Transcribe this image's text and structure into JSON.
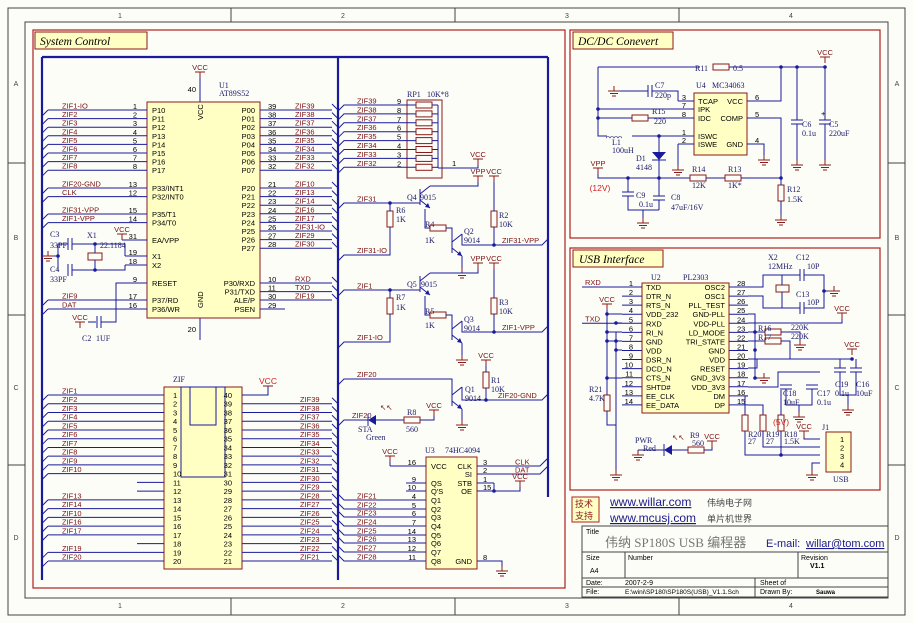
{
  "frame": {
    "columns": [
      "1",
      "2",
      "3",
      "4"
    ],
    "rows": [
      "A",
      "B",
      "C",
      "D"
    ]
  },
  "sections": {
    "system": "System Control",
    "dcdc": "DC/DC Conevert",
    "usb": "USB Interface"
  },
  "power": {
    "vcc": "VCC",
    "vpp": "VPP",
    "v12": "(12V)",
    "v5": "(5V)"
  },
  "u1": {
    "ref": "U1",
    "part": "AT89S52",
    "vcc_pin": "40",
    "vcc": "VCC",
    "gnd_pin": "20",
    "gnd": "GND",
    "left": [
      [
        "1",
        "P10",
        "ZIF1-IO"
      ],
      [
        "2",
        "P11",
        "ZIF2"
      ],
      [
        "3",
        "P12",
        "ZIF3"
      ],
      [
        "4",
        "P13",
        "ZIF4"
      ],
      [
        "5",
        "P14",
        "ZIF5"
      ],
      [
        "6",
        "P15",
        "ZIF6"
      ],
      [
        "7",
        "P16",
        "ZIF7"
      ],
      [
        "8",
        "P17",
        "ZIF8"
      ],
      [
        "13",
        "P33/INT1",
        "ZIF20-GND"
      ],
      [
        "12",
        "P32/INT0",
        "CLK"
      ],
      [
        "15",
        "P35/T1",
        "ZIF31-VPP"
      ],
      [
        "14",
        "P34/T0",
        "ZIF1-VPP"
      ],
      [
        "31",
        "EA/VPP",
        ""
      ],
      [
        "19",
        "X1",
        ""
      ],
      [
        "18",
        "X2",
        ""
      ],
      [
        "9",
        "RESET",
        ""
      ],
      [
        "17",
        "P37/RD",
        "ZIF9"
      ],
      [
        "16",
        "P36/WR",
        "DAT"
      ]
    ],
    "right": [
      [
        "39",
        "P00",
        "ZIF39"
      ],
      [
        "38",
        "P01",
        "ZIF38"
      ],
      [
        "37",
        "P02",
        "ZIF37"
      ],
      [
        "36",
        "P03",
        "ZIF36"
      ],
      [
        "35",
        "P04",
        "ZIF35"
      ],
      [
        "34",
        "P05",
        "ZIF34"
      ],
      [
        "33",
        "P06",
        "ZIF33"
      ],
      [
        "32",
        "P07",
        "ZIF32"
      ],
      [
        "21",
        "P20",
        "ZIF10"
      ],
      [
        "22",
        "P21",
        "ZIF13"
      ],
      [
        "23",
        "P22",
        "ZIF14"
      ],
      [
        "24",
        "P23",
        "ZIF16"
      ],
      [
        "25",
        "P24",
        "ZIF17"
      ],
      [
        "26",
        "P25",
        "ZIF31-IO"
      ],
      [
        "27",
        "P26",
        "ZIF29"
      ],
      [
        "28",
        "P27",
        "ZIF30"
      ],
      [
        "10",
        "P30/RXD",
        "RXD"
      ],
      [
        "11",
        "P31/TXD",
        "TXD"
      ],
      [
        "30",
        "ALE/P",
        "ZIF19"
      ],
      [
        "29",
        "PSEN",
        ""
      ]
    ]
  },
  "zif": {
    "ref": "ZIF",
    "left": [
      [
        "1",
        "ZIF1"
      ],
      [
        "2",
        "ZIF2"
      ],
      [
        "3",
        "ZIF3"
      ],
      [
        "4",
        "ZIF4"
      ],
      [
        "5",
        "ZIF5"
      ],
      [
        "6",
        "ZIF6"
      ],
      [
        "7",
        "ZIF7"
      ],
      [
        "8",
        "ZIF8"
      ],
      [
        "9",
        "ZIF9"
      ],
      [
        "10",
        "ZIF10"
      ],
      [
        "11",
        ""
      ],
      [
        "12",
        ""
      ],
      [
        "13",
        "ZIF13"
      ],
      [
        "14",
        "ZIF14"
      ],
      [
        "15",
        "ZIF10"
      ],
      [
        "16",
        "ZIF16"
      ],
      [
        "17",
        "ZIF17"
      ],
      [
        "18",
        ""
      ],
      [
        "19",
        "ZIF19"
      ],
      [
        "20",
        "ZIF20"
      ]
    ],
    "right": [
      [
        "40",
        "VCC"
      ],
      [
        "39",
        "ZIF39"
      ],
      [
        "38",
        "ZIF38"
      ],
      [
        "37",
        "ZIF37"
      ],
      [
        "36",
        "ZIF36"
      ],
      [
        "35",
        "ZIF35"
      ],
      [
        "34",
        "ZIF34"
      ],
      [
        "33",
        "ZIF33"
      ],
      [
        "32",
        "ZIF32"
      ],
      [
        "31",
        "ZIF31"
      ],
      [
        "30",
        "ZIF30"
      ],
      [
        "29",
        "ZIF29"
      ],
      [
        "28",
        "ZIF28"
      ],
      [
        "27",
        "ZIF27"
      ],
      [
        "26",
        "ZIF26"
      ],
      [
        "25",
        "ZIF25"
      ],
      [
        "24",
        "ZIF24"
      ],
      [
        "23",
        "ZIF23"
      ],
      [
        "22",
        "ZIF22"
      ],
      [
        "21",
        "ZIF21"
      ]
    ]
  },
  "rp1": {
    "ref": "RP1",
    "value": "10K*8",
    "common_pin": "1",
    "pins": [
      [
        "9",
        "ZIF39"
      ],
      [
        "8",
        "ZIF38"
      ],
      [
        "7",
        "ZIF37"
      ],
      [
        "6",
        "ZIF36"
      ],
      [
        "5",
        "ZIF35"
      ],
      [
        "4",
        "ZIF34"
      ],
      [
        "3",
        "ZIF33"
      ],
      [
        "2",
        "ZIF32"
      ]
    ]
  },
  "drivers": {
    "nets": {
      "zif31": "ZIF31",
      "zif31io": "ZIF31-IO",
      "zif31vpp": "ZIF31-VPP",
      "zif1": "ZIF1",
      "zif1io": "ZIF1-IO",
      "zif1vpp": "ZIF1-VPP",
      "zif20": "ZIF20",
      "zif20gnd": "ZIF20-GND",
      "zif20led": "ZIF20"
    }
  },
  "u3": {
    "ref": "U3",
    "part": "74HC4094",
    "left": [
      [
        "16",
        "VCC",
        ""
      ],
      [
        "9",
        "QS",
        ""
      ],
      [
        "10",
        "Q'S",
        ""
      ],
      [
        "4",
        "Q1",
        "ZIF21"
      ],
      [
        "5",
        "Q2",
        "ZIF22"
      ],
      [
        "6",
        "Q3",
        "ZIF23"
      ],
      [
        "7",
        "Q4",
        "ZIF24"
      ],
      [
        "14",
        "Q5",
        "ZIF25"
      ],
      [
        "13",
        "Q6",
        "ZIF26"
      ],
      [
        "12",
        "Q7",
        "ZIF27"
      ],
      [
        "11",
        "Q8",
        "ZIF28"
      ]
    ],
    "right": [
      [
        "3",
        "CLK",
        "CLK"
      ],
      [
        "2",
        "SI",
        "DAT"
      ],
      [
        "1",
        "STB",
        ""
      ],
      [
        "15",
        "OE",
        ""
      ],
      [
        "8",
        "GND",
        ""
      ]
    ]
  },
  "u4": {
    "ref": "U4",
    "part": "MC34063",
    "left": [
      [
        "3",
        "TCAP"
      ],
      [
        "7",
        "IPK"
      ],
      [
        "8",
        "IDC"
      ],
      [
        "1",
        "ISWC"
      ],
      [
        "2",
        "ISWE"
      ]
    ],
    "right": [
      [
        "6",
        "VCC"
      ],
      [
        "5",
        "COMP"
      ],
      [
        "4",
        "GND"
      ]
    ]
  },
  "u2": {
    "ref": "U2",
    "part": "PL2303",
    "left": [
      [
        "1",
        "TXD",
        "RXD"
      ],
      [
        "2",
        "DTR_N",
        ""
      ],
      [
        "3",
        "RTS_N",
        ""
      ],
      [
        "4",
        "VDD_232",
        ""
      ],
      [
        "5",
        "RXD",
        "TXD"
      ],
      [
        "6",
        "RI_N",
        ""
      ],
      [
        "7",
        "GND",
        ""
      ],
      [
        "8",
        "VDD",
        ""
      ],
      [
        "9",
        "DSR_N",
        ""
      ],
      [
        "10",
        "DCD_N",
        ""
      ],
      [
        "11",
        "CTS_N",
        ""
      ],
      [
        "12",
        "SHTD#",
        ""
      ],
      [
        "13",
        "EE_CLK",
        ""
      ],
      [
        "14",
        "EE_DATA",
        ""
      ]
    ],
    "right": [
      [
        "28",
        "OSC2"
      ],
      [
        "27",
        "OSC1"
      ],
      [
        "26",
        "PLL_TEST"
      ],
      [
        "25",
        "GND-PLL"
      ],
      [
        "24",
        "VDD-PLL"
      ],
      [
        "23",
        "LD_MODE"
      ],
      [
        "22",
        "TRI_STATE"
      ],
      [
        "21",
        "GND"
      ],
      [
        "20",
        "VDD"
      ],
      [
        "19",
        "RESET"
      ],
      [
        "18",
        "GND_3V3"
      ],
      [
        "17",
        "VDD_3V3"
      ],
      [
        "16",
        "DM"
      ],
      [
        "15",
        "DP"
      ]
    ]
  },
  "j1": {
    "ref": "J1",
    "name": "USB",
    "pins": [
      "1",
      "2",
      "3",
      "4"
    ]
  },
  "parts": [
    [
      "C3",
      "33PF"
    ],
    [
      "X1",
      "22.1184"
    ],
    [
      "C4",
      "33PF"
    ],
    [
      "C2",
      "1UF"
    ],
    [
      "Q4",
      "9015"
    ],
    [
      "R6",
      "1K"
    ],
    [
      "R4",
      "1K"
    ],
    [
      "Q2",
      "9014"
    ],
    [
      "R2",
      "10K"
    ],
    [
      "Q5",
      "9015"
    ],
    [
      "R7",
      "1K"
    ],
    [
      "R5",
      "1K"
    ],
    [
      "Q3",
      "9014"
    ],
    [
      "R3",
      "10K"
    ],
    [
      "Q1",
      "9014"
    ],
    [
      "R1",
      "10K"
    ],
    [
      "R8",
      "560"
    ],
    [
      "STA",
      "Green"
    ],
    [
      "R11",
      "0.5"
    ],
    [
      "C7",
      "220p"
    ],
    [
      "R15",
      "220"
    ],
    [
      "L1",
      "100uH"
    ],
    [
      "D1",
      "4148"
    ],
    [
      "C6",
      "0.1u"
    ],
    [
      "C5",
      "220uF"
    ],
    [
      "R14",
      "12K"
    ],
    [
      "R13",
      "1K*"
    ],
    [
      "R12",
      "1.5K"
    ],
    [
      "C9",
      "0.1u"
    ],
    [
      "C8",
      "47uF/16V"
    ],
    [
      "X2",
      "12MHz"
    ],
    [
      "C12",
      "10P"
    ],
    [
      "C13",
      "10P"
    ],
    [
      "R16",
      "220K"
    ],
    [
      "R17",
      "220K"
    ],
    [
      "R21",
      "4.7K"
    ],
    [
      "C18",
      "10uF"
    ],
    [
      "C17",
      "0.1u"
    ],
    [
      "C19",
      "0.1u"
    ],
    [
      "C16",
      "10uF"
    ],
    [
      "R20",
      "27"
    ],
    [
      "R19",
      "27"
    ],
    [
      "R18",
      "1.5K"
    ],
    [
      "R9",
      "560"
    ],
    [
      "PWR",
      "Red"
    ]
  ],
  "support": {
    "badge": [
      "技术",
      "支持"
    ],
    "links": [
      {
        "url": "www.willar.com",
        "desc": "伟纳电子网"
      },
      {
        "url": "www.mcusj.com",
        "desc": "单片机世界"
      }
    ]
  },
  "titleblock": {
    "title_label": "Title",
    "title": "伟纳  SP180S  USB  编程器",
    "email_label": "E-mail: ",
    "email": "willar@tom.com",
    "size_label": "Size",
    "size": "A4",
    "number_label": "Number",
    "revision_label": "Revision",
    "revision": "V1.1",
    "date_label": "Date:",
    "date": "2007-2-9",
    "sheet_label": "Sheet    of",
    "file_label": "File:",
    "file": "E:\\wini\\SP180\\SP180S(USB)_V1.1.Sch",
    "drawn_label": "Drawn By:",
    "drawn": "Sauwa"
  }
}
